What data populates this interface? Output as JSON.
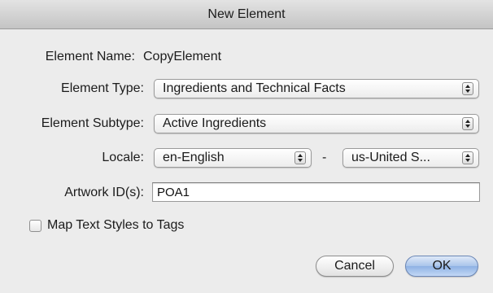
{
  "window": {
    "title": "New Element"
  },
  "form": {
    "element_name": {
      "label": "Element Name:",
      "value": "CopyElement"
    },
    "element_type": {
      "label": "Element Type:",
      "value": "Ingredients and Technical Facts"
    },
    "element_subtype": {
      "label": "Element Subtype:",
      "value": "Active Ingredients"
    },
    "locale": {
      "label": "Locale:",
      "language": "en-English",
      "separator": "-",
      "region": "us-United S..."
    },
    "artwork_ids": {
      "label": "Artwork ID(s):",
      "value": "POA1"
    },
    "map_text_styles": {
      "label": "Map Text Styles to Tags",
      "checked": false
    }
  },
  "buttons": {
    "cancel_label": "Cancel",
    "ok_label": "OK"
  },
  "icons": {
    "popup_stepper": "up-down-arrows-icon"
  },
  "colors": {
    "window_bg": "#ececec",
    "default_button": "#a9c4ea"
  }
}
